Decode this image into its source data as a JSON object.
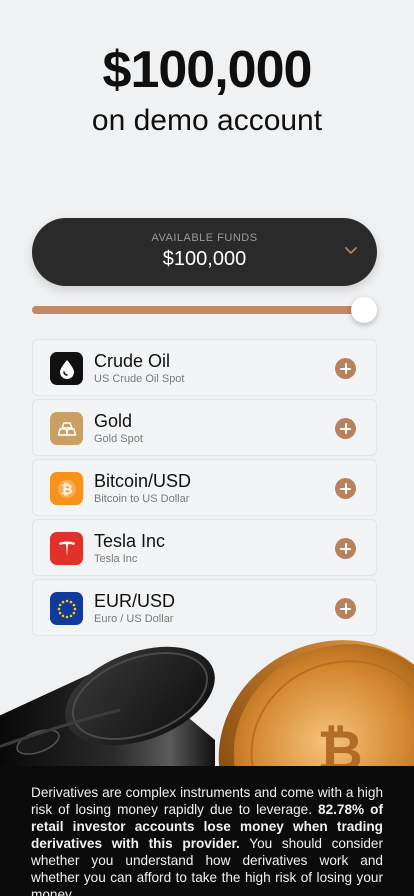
{
  "hero": {
    "amount": "$100,000",
    "subtitle": "on demo account"
  },
  "funds": {
    "label": "AVAILABLE FUNDS",
    "value": "$100,000",
    "chevron_icon": "chevron-down-icon"
  },
  "slider": {
    "level": 1.0,
    "track_color": "#c08a62"
  },
  "assets": [
    {
      "name": "Crude Oil",
      "subtitle": "US Crude Oil Spot",
      "icon": "oil-drop-icon",
      "icon_bg": "#111111"
    },
    {
      "name": "Gold",
      "subtitle": "Gold Spot",
      "icon": "gold-bars-icon",
      "icon_bg": "#c9a063"
    },
    {
      "name": "Bitcoin/USD",
      "subtitle": "Bitcoin to US Dollar",
      "icon": "bitcoin-icon",
      "icon_bg": "#f7931a"
    },
    {
      "name": "Tesla Inc",
      "subtitle": "Tesla Inc",
      "icon": "tesla-logo-icon",
      "icon_bg": "#e0312b"
    },
    {
      "name": "EUR/USD",
      "subtitle": "Euro / US Dollar",
      "icon": "eu-flag-icon",
      "icon_bg": "#123a9c"
    }
  ],
  "disclaimer": {
    "part1": "Derivatives are complex instruments and come with a high risk of losing money rapidly due to leverage. ",
    "bold": "82.78% of retail investor accounts lose money when trading derivatives with this provider.",
    "part2": " You should consider whether you understand how derivatives work and whether you can afford to take the high risk of losing your money."
  },
  "colors": {
    "accent": "#b7825d",
    "background": "#f0f1f2",
    "dark": "#2a2a2a"
  }
}
